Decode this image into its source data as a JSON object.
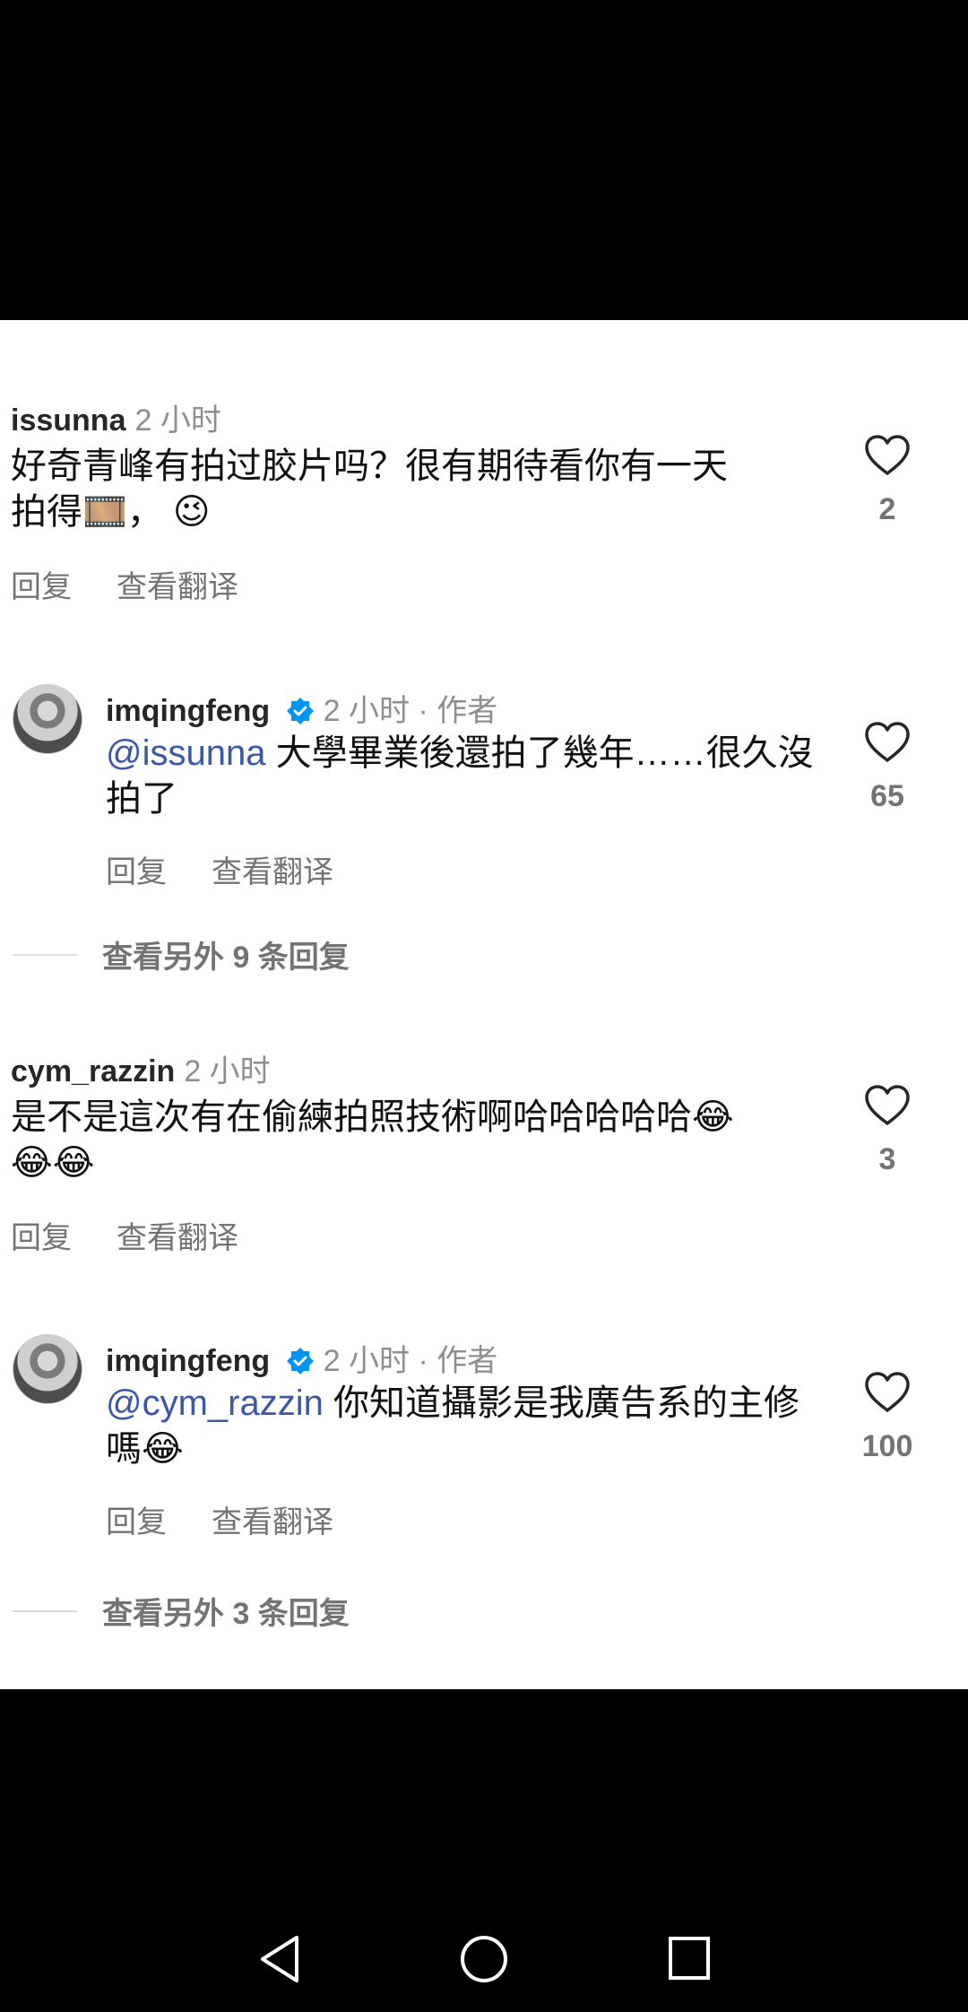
{
  "comments": [
    {
      "user": "issunna",
      "time": "2 小时",
      "text": "好奇青峰有拍过胶片吗？很有期待看你有一天拍得🎞️， 😉",
      "likes": "2",
      "reply_label": "回复",
      "translate_label": "查看翻译"
    },
    {
      "user": "imqingfeng",
      "time": "2 小时",
      "author_tag": " · 作者",
      "mention": "@issunna",
      "text": " 大學畢業後還拍了幾年……很久沒拍了",
      "likes": "65",
      "reply_label": "回复",
      "translate_label": "查看翻译"
    },
    {
      "user": "cym_razzin",
      "time": "2 小时",
      "text": "是不是這次有在偷練拍照技術啊哈哈哈哈哈😂😂😂",
      "likes": "3",
      "reply_label": "回复",
      "translate_label": "查看翻译"
    },
    {
      "user": "imqingfeng",
      "time": "2 小时",
      "author_tag": " · 作者",
      "mention": "@cym_razzin",
      "text": " 你知道攝影是我廣告系的主修嗎😂",
      "likes": "100",
      "reply_label": "回复",
      "translate_label": "查看翻译"
    }
  ],
  "more_replies": [
    {
      "label": "查看另外 9 条回复"
    },
    {
      "label": "查看另外 3 条回复"
    }
  ],
  "icons": {
    "like": "heart-outline-icon",
    "verified": "verified-badge-icon",
    "nav_back": "triangle-back-icon",
    "nav_home": "circle-home-icon",
    "nav_recents": "square-recents-icon"
  },
  "colors": {
    "mention": "#3a57a8",
    "verified": "#0095f6",
    "muted": "#737373"
  }
}
